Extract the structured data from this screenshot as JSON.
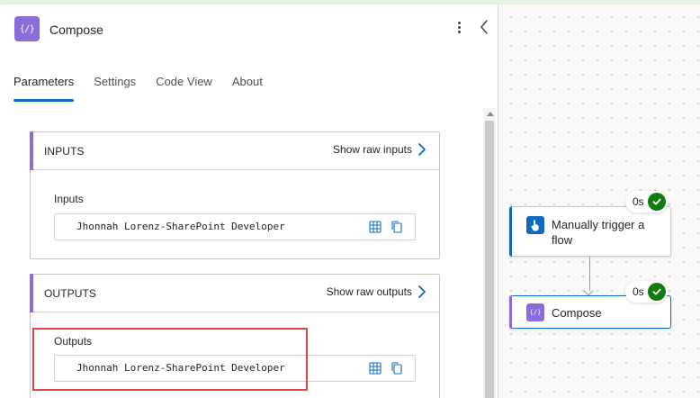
{
  "panel": {
    "title": "Compose",
    "action_icon_glyph": "{/}",
    "tabs": [
      {
        "label": "Parameters",
        "active": true
      },
      {
        "label": "Settings",
        "active": false
      },
      {
        "label": "Code View",
        "active": false
      },
      {
        "label": "About",
        "active": false
      }
    ]
  },
  "inputs_card": {
    "title": "INPUTS",
    "raw_link": "Show raw inputs",
    "field_label": "Inputs",
    "value": "Jhonnah Lorenz-SharePoint Developer"
  },
  "outputs_card": {
    "title": "OUTPUTS",
    "raw_link": "Show raw outputs",
    "field_label": "Outputs",
    "value": "Jhonnah Lorenz-SharePoint Developer"
  },
  "canvas": {
    "trigger_node": {
      "label": "Manually trigger a flow",
      "duration": "0s",
      "status": "succeeded"
    },
    "compose_node": {
      "label": "Compose",
      "duration": "0s",
      "status": "succeeded",
      "icon_glyph": "{/}"
    }
  },
  "colors": {
    "accent": "#0f6cbd",
    "compose_purple": "#8c6cda",
    "success_green": "#107c10",
    "highlight_red": "#e04444"
  }
}
